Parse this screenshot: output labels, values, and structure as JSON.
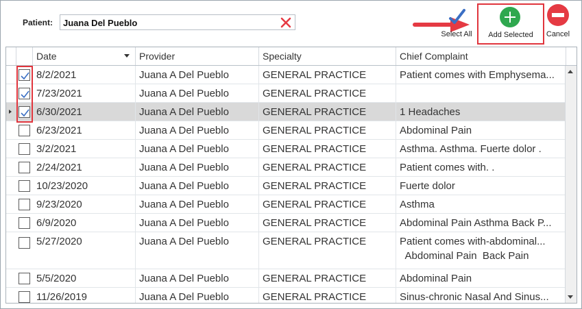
{
  "patient": {
    "label": "Patient:",
    "value": "Juana Del Pueblo"
  },
  "toolbar": {
    "select_all_label": "Select All",
    "add_selected_label": "Add Selected",
    "cancel_label": "Cancel"
  },
  "colors": {
    "highlight": "#e0343c",
    "add": "#2fa84f",
    "cancel": "#e53a43",
    "select_all_check": "#3b6fc4",
    "arrow": "#e53a43"
  },
  "grid": {
    "columns": [
      "Date",
      "Provider",
      "Specialty",
      "Chief Complaint"
    ],
    "sort_column": "Date",
    "rows": [
      {
        "checked": true,
        "selected": false,
        "date": "8/2/2021",
        "provider": "Juana A Del Pueblo",
        "specialty": "GENERAL PRACTICE",
        "complaint": "Patient comes with  Emphysema...",
        "complaint2": ""
      },
      {
        "checked": true,
        "selected": false,
        "date": "7/23/2021",
        "provider": "Juana A Del Pueblo",
        "specialty": "GENERAL PRACTICE",
        "complaint": "",
        "complaint2": ""
      },
      {
        "checked": true,
        "selected": true,
        "date": "6/30/2021",
        "provider": "Juana A Del Pueblo",
        "specialty": "GENERAL PRACTICE",
        "complaint": "1  Headaches",
        "complaint2": ""
      },
      {
        "checked": false,
        "selected": false,
        "date": "6/23/2021",
        "provider": "Juana A Del Pueblo",
        "specialty": "GENERAL PRACTICE",
        "complaint": "Abdominal Pain",
        "complaint2": ""
      },
      {
        "checked": false,
        "selected": false,
        "date": "3/2/2021",
        "provider": "Juana A Del Pueblo",
        "specialty": "GENERAL PRACTICE",
        "complaint": "Asthma.   Asthma.   Fuerte dolor .",
        "complaint2": ""
      },
      {
        "checked": false,
        "selected": false,
        "date": "2/24/2021",
        "provider": "Juana A Del Pueblo",
        "specialty": "GENERAL PRACTICE",
        "complaint": "Patient comes with. .",
        "complaint2": ""
      },
      {
        "checked": false,
        "selected": false,
        "date": "10/23/2020",
        "provider": "Juana A Del Pueblo",
        "specialty": "GENERAL PRACTICE",
        "complaint": "Fuerte dolor",
        "complaint2": ""
      },
      {
        "checked": false,
        "selected": false,
        "date": "9/23/2020",
        "provider": "Juana A Del Pueblo",
        "specialty": "GENERAL PRACTICE",
        "complaint": "Asthma",
        "complaint2": ""
      },
      {
        "checked": false,
        "selected": false,
        "date": "6/9/2020",
        "provider": "Juana A Del Pueblo",
        "specialty": "GENERAL PRACTICE",
        "complaint": "Abdominal Pain  Asthma  Back P...",
        "complaint2": ""
      },
      {
        "checked": false,
        "selected": false,
        "date": "5/27/2020",
        "provider": "Juana A Del Pueblo",
        "specialty": "GENERAL PRACTICE",
        "complaint": "Patient comes with-abdominal...",
        "complaint2": "  Abdominal Pain  Back Pain"
      },
      {
        "checked": false,
        "selected": false,
        "date": "5/5/2020",
        "provider": "Juana A Del Pueblo",
        "specialty": "GENERAL PRACTICE",
        "complaint": "Abdominal Pain",
        "complaint2": ""
      },
      {
        "checked": false,
        "selected": false,
        "date": "11/26/2019",
        "provider": "Juana A Del Pueblo",
        "specialty": "GENERAL PRACTICE",
        "complaint": "Sinus-chronic  Nasal And Sinus...",
        "complaint2": ""
      }
    ]
  }
}
